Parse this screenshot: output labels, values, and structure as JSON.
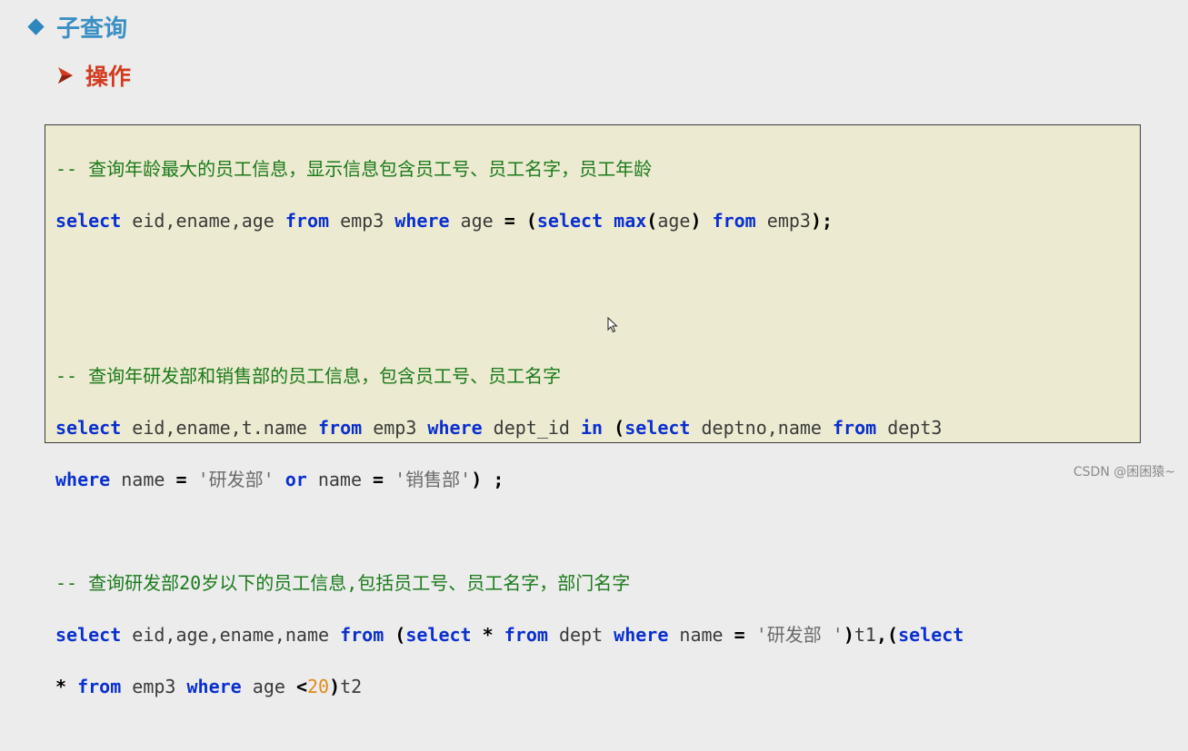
{
  "heading": {
    "title": "子查询",
    "subtitle": "操作"
  },
  "code": {
    "block1": {
      "comment": "-- 查询年龄最大的员工信息，显示信息包含员工号、员工名字，员工年龄",
      "l1": {
        "k1": "select",
        "t1": " eid,ename,age ",
        "k2": "from",
        "t2": " emp3 ",
        "k3": "where",
        "t3": " age ",
        "o1": "=",
        "t4": " ",
        "o2": "(",
        "k4": "select",
        "t5": " ",
        "k5": "max",
        "o3": "(",
        "t6": "age",
        "o4": ")",
        "t7": " ",
        "k6": "from",
        "t8": " emp3",
        "o5": ");"
      }
    },
    "block2": {
      "comment": "-- 查询年研发部和销售部的员工信息，包含员工号、员工名字",
      "l1": {
        "k1": "select",
        "t1": " eid,ename,t.name ",
        "k2": "from",
        "t2": " emp3 ",
        "k3": "where",
        "t3": " dept_id ",
        "k4": "in",
        "t4": " ",
        "o1": "(",
        "k5": "select",
        "t5": " deptno,name ",
        "k6": "from",
        "t6": " dept3"
      },
      "l2": {
        "k1": "where",
        "t1": " name ",
        "o1": "=",
        "t2": " ",
        "s1": "'研发部'",
        "t3": " ",
        "k2": "or",
        "t4": " name ",
        "o2": "=",
        "t5": " ",
        "s2": "'销售部'",
        "o3": ")",
        "t6": " ",
        "o4": ";"
      }
    },
    "block3": {
      "comment": "-- 查询研发部20岁以下的员工信息,包括员工号、员工名字，部门名字",
      "l1": {
        "k1": "select",
        "t1": " eid,age,ename,name ",
        "k2": "from",
        "t2": " ",
        "o1": "(",
        "k3": "select",
        "t3": " ",
        "o2": "*",
        "t4": " ",
        "k4": "from",
        "t5": " dept ",
        "k5": "where",
        "t6": " name ",
        "o3": "=",
        "t7": " ",
        "s1": "'研发部 '",
        "o4": ")",
        "t8": "t1",
        "o5": ",(",
        "k6": "select"
      },
      "l2": {
        "o1": "*",
        "t1": " ",
        "k1": "from",
        "t2": " emp3 ",
        "k2": "where",
        "t3": " age ",
        "o2": "<",
        "n1": "20",
        "o3": ")",
        "t4": "t2"
      }
    }
  },
  "watermark": "CSDN @困困猿~",
  "colors": {
    "heading": "#3a8fc4",
    "subheading": "#d23a1f",
    "panel": "#ecead0",
    "keyword": "#0a2fd0",
    "comment": "#1a7a1a",
    "string": "#6a6a6a",
    "number": "#e08a1a"
  },
  "icons": {
    "bullet": "diamond-bullet-icon",
    "sub_bullet": "arrow-bullet-icon",
    "cursor": "mouse-cursor-icon"
  }
}
